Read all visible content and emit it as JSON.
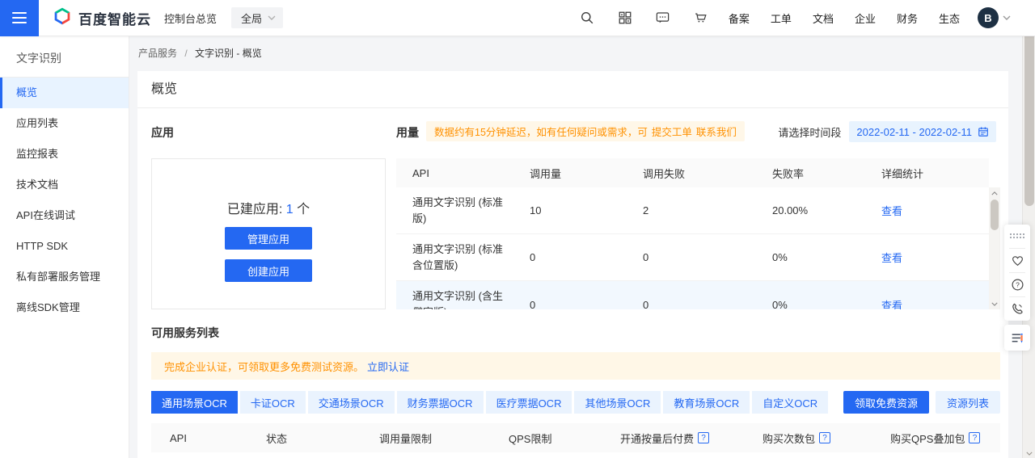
{
  "colors": {
    "accent": "#2468f2",
    "orange": "#ff9100",
    "tab_bg": "#eaf3fe",
    "banner_bg": "#fff7e7",
    "active_side_bg": "#e8f3ff"
  },
  "topnav": {
    "brand": "百度智能云",
    "console_overview": "控制台总览",
    "region": "全局",
    "icons": [
      "search-icon",
      "apps-grid-icon",
      "message-icon",
      "cart-icon"
    ],
    "links": [
      "备案",
      "工单",
      "文档",
      "企业",
      "财务",
      "生态"
    ],
    "avatar_initial": "B"
  },
  "sidebar": {
    "title": "文字识别",
    "items": [
      {
        "label": "概览",
        "active": true
      },
      {
        "label": "应用列表",
        "active": false
      },
      {
        "label": "监控报表",
        "active": false
      },
      {
        "label": "技术文档",
        "active": false
      },
      {
        "label": "API在线调试",
        "active": false
      },
      {
        "label": "HTTP SDK",
        "active": false
      },
      {
        "label": "私有部署服务管理",
        "active": false
      },
      {
        "label": "离线SDK管理",
        "active": false
      }
    ]
  },
  "breadcrumb": {
    "parent": "产品服务",
    "separator": "/",
    "current": "文字识别 - 概览"
  },
  "page": {
    "title": "概览"
  },
  "app_section": {
    "title": "应用",
    "built_label": "已建应用:",
    "built_count": "1",
    "built_unit": "个",
    "manage_button": "管理应用",
    "create_button": "创建应用"
  },
  "usage_section": {
    "title": "用量",
    "notice_text": "数据约有15分钟延迟，如有任何疑问或需求，可",
    "notice_link1": "提交工单",
    "notice_link2": "联系我们",
    "date_label": "请选择时间段",
    "date_range": "2022-02-11 - 2022-02-11",
    "table": {
      "headers": [
        "API",
        "调用量",
        "调用失败",
        "失败率",
        "详细统计"
      ],
      "rows": [
        {
          "api": "通用文字识别 (标准版)",
          "calls": "10",
          "fails": "2",
          "fail_rate": "20.00%",
          "action": "查看"
        },
        {
          "api": "通用文字识别 (标准含位置版)",
          "calls": "0",
          "fails": "0",
          "fail_rate": "0%",
          "action": "查看"
        },
        {
          "api": "通用文字识别 (含生僻字版)",
          "calls": "0",
          "fails": "0",
          "fail_rate": "0%",
          "action": "查看"
        }
      ]
    }
  },
  "services_section": {
    "title": "可用服务列表",
    "banner_text": "完成企业认证，可领取更多免费测试资源。",
    "banner_link": "立即认证",
    "tabs": [
      {
        "label": "通用场景OCR",
        "active": true
      },
      {
        "label": "卡证OCR",
        "active": false
      },
      {
        "label": "交通场景OCR",
        "active": false
      },
      {
        "label": "财务票据OCR",
        "active": false
      },
      {
        "label": "医疗票据OCR",
        "active": false
      },
      {
        "label": "其他场景OCR",
        "active": false
      },
      {
        "label": "教育场景OCR",
        "active": false
      },
      {
        "label": "自定义OCR",
        "active": false
      }
    ],
    "free_button": "领取免费资源",
    "list_button": "资源列表",
    "table_headers": [
      {
        "label": "API",
        "help": false
      },
      {
        "label": "状态",
        "help": false
      },
      {
        "label": "调用量限制",
        "help": false
      },
      {
        "label": "QPS限制",
        "help": false
      },
      {
        "label": "开通按量后付费",
        "help": true
      },
      {
        "label": "购买次数包",
        "help": true
      },
      {
        "label": "购买QPS叠加包",
        "help": true
      }
    ],
    "help_glyph": "?"
  }
}
